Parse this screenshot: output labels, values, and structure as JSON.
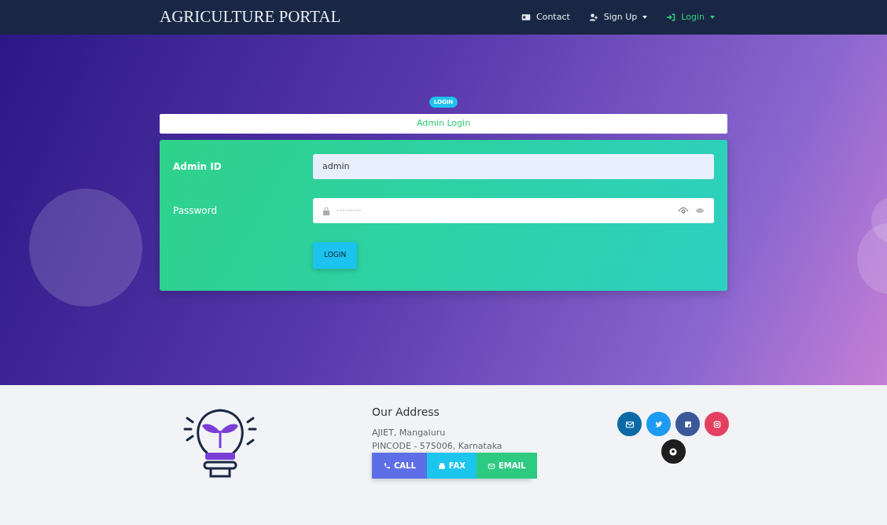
{
  "navbar": {
    "brand": "AGRICULTURE PORTAL",
    "items": [
      {
        "kind": "link",
        "label": "Contact",
        "dropdown": false,
        "active": false
      },
      {
        "kind": "link",
        "label": "Sign Up",
        "dropdown": true,
        "active": false
      },
      {
        "kind": "link",
        "label": "Login",
        "dropdown": true,
        "active": true
      }
    ]
  },
  "login": {
    "badge": "LOGIN",
    "title": "Admin Login",
    "fields": [
      {
        "kind": "text",
        "label": "Admin ID",
        "value": "admin"
      },
      {
        "kind": "password",
        "label": "Password",
        "value": "·········"
      }
    ],
    "submit": "LOGIN"
  },
  "footer": {
    "heading": "Our Address",
    "lines": [
      "AJIET, Mangaluru",
      "PINCODE - 575006, Karnataka"
    ],
    "buttons": [
      {
        "label": "CALL",
        "color": "#5e6ee6"
      },
      {
        "label": "FAX",
        "color": "#1bc5ee"
      },
      {
        "label": "EMAIL",
        "color": "#2dcb81"
      }
    ],
    "socials": [
      {
        "color": "#0b6aa6"
      },
      {
        "color": "#1d9bf0"
      },
      {
        "color": "#3b5998"
      },
      {
        "color": "#e4405f"
      },
      {
        "color": "#1e1e1e"
      }
    ]
  }
}
